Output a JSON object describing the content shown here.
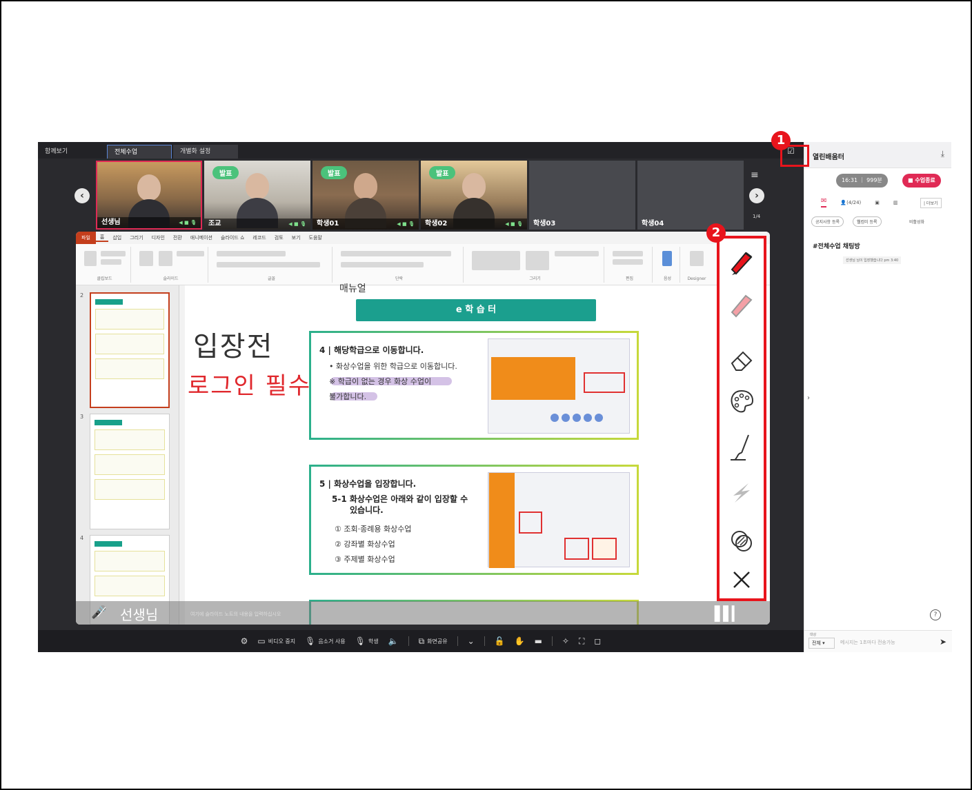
{
  "top_tabs": [
    "함께보기",
    "전체수업",
    "개별화 설정"
  ],
  "participants": [
    {
      "name": "선생님",
      "badge": ""
    },
    {
      "name": "조교",
      "badge": "발표"
    },
    {
      "name": "학생01",
      "badge": "발표"
    },
    {
      "name": "학생02",
      "badge": "발표"
    },
    {
      "name": "학생03",
      "badge": ""
    },
    {
      "name": "학생04",
      "badge": ""
    }
  ],
  "strip_page": "1/4",
  "ppt": {
    "tabs": [
      "파일",
      "홈",
      "삽입",
      "그리기",
      "디자인",
      "전환",
      "애니메이션",
      "슬라이드 쇼",
      "레코드",
      "검토",
      "보기",
      "도움말"
    ],
    "groups": [
      "클립보드",
      "슬라이드",
      "글꼴",
      "단락",
      "그리기",
      "편집",
      "음성",
      "Designer"
    ],
    "slide_numbers": [
      "2",
      "3",
      "4"
    ]
  },
  "slide": {
    "header": "매뉴얼",
    "title": "e 학 습 터",
    "handwriting_black": "입장전",
    "handwriting_red": "로그인 필수",
    "card1": {
      "heading": "4 | 해당학급으로 이동합니다.",
      "line1": "• 화상수업을 위한 학급으로 이동합니다.",
      "line2": "※ 학급이 없는 경우 화상 수업이",
      "line3": "불가합니다."
    },
    "card2": {
      "heading": "5 | 화상수업을 입장합니다.",
      "sub1": "5-1 화상수업은 아래와 같이 입장할 수",
      "sub2": "있습니다.",
      "item1": "① 조회·종례용 화상수업",
      "item2": "② 강좌별 화상수업",
      "item3": "③ 주제별 화상수업"
    }
  },
  "overlay": {
    "teacher": "선생님",
    "note": "여기에 슬라이드 노트의 내용을 입력하십시오"
  },
  "callouts": [
    "1",
    "2"
  ],
  "draw_tools": [
    "pen-icon",
    "highlighter-icon",
    "eraser-icon",
    "palette-icon",
    "brush-icon",
    "laser-icon",
    "shape-icon",
    "close-icon"
  ],
  "controls": {
    "video": "비디오 중지",
    "audio": "음소거 사용",
    "student": "학생",
    "share": "화면공유"
  },
  "side": {
    "title": "열린배움터",
    "timer": "16:31 ｜ 999분",
    "end": "■ 수업종료",
    "count": "(4/24)",
    "more": "| 더보기",
    "chip1": "공지사항 등록",
    "chip2": "웰컴미 등록",
    "toggle": "비활성화",
    "room": "#전체수업 채팅방",
    "sys": "선생님 님이 입장했습니다 pm 3:40",
    "target_label": "대상",
    "target_value": "전체 ▾",
    "placeholder": "메시지는 1초마다 전송가능"
  },
  "colors": {
    "accent": "#e02a55",
    "highlight": "#e8141c",
    "teal": "#1b9f8e"
  }
}
